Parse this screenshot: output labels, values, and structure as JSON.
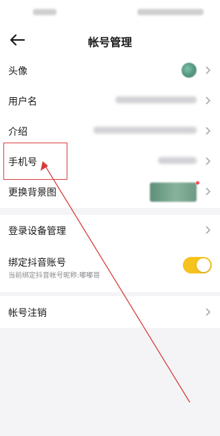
{
  "header": {
    "title": "帐号管理"
  },
  "group1": {
    "items": [
      {
        "label": "头像"
      },
      {
        "label": "用户名"
      },
      {
        "label": "介绍"
      },
      {
        "label": "手机号"
      },
      {
        "label": "更换背景图"
      }
    ]
  },
  "group2": {
    "device_label": "登录设备管理",
    "douyin_label": "绑定抖音账号",
    "douyin_sub": "当前绑定抖音帐号昵称:嘟嘟哥",
    "douyin_toggle_on": true
  },
  "group3": {
    "cancel_label": "帐号注销"
  },
  "icons": {
    "back": "back-arrow-icon",
    "chevron": "chevron-right-icon"
  },
  "colors": {
    "toggle_on": "#f6c21c",
    "annotation": "#d63b3b",
    "background": "#f4f4f6"
  }
}
